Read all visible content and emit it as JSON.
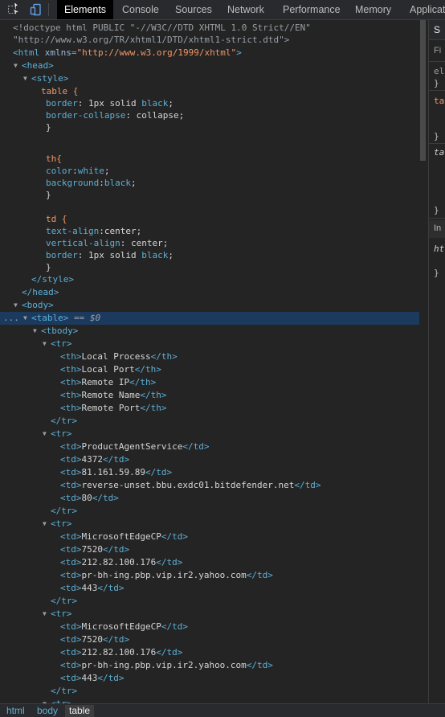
{
  "toolbar": {
    "tabs": [
      "Elements",
      "Console",
      "Sources",
      "Network",
      "Performance",
      "Memory",
      "Applicat"
    ],
    "active_tab": "Elements"
  },
  "side_panel": {
    "tab_label": "S",
    "filter_placeholder": "Fi",
    "text_el": "el",
    "brace_close_1": "}",
    "text_ta_1": "ta",
    "brace_close_2": "}",
    "text_ta_2": "ta",
    "brace_close_3": "}",
    "text_in": "In",
    "text_ht": "ht",
    "brace_close_4": "}"
  },
  "code": {
    "doctype_1": "<!doctype html PUBLIC \"-//W3C//DTD XHTML 1.0 Strict//EN\"",
    "doctype_2": "\"http://www.w3.org/TR/xhtml1/DTD/xhtml1-strict.dtd\">",
    "html_open_tag": "<html",
    "xmlns_attr": "xmlns",
    "xmlns_val": "\"http://www.w3.org/1999/xhtml\"",
    "html_close_bracket": ">",
    "head_open": "<head>",
    "style_open": "<style>",
    "css_table_sel": "table {",
    "css_border_prop": "border",
    "css_border_val_1": ": 1px solid ",
    "css_black": "black",
    "css_semicolon": ";",
    "css_collapse_prop": "border-collapse",
    "css_collapse_val": ": collapse;",
    "css_close": "}",
    "css_th_sel": "th{",
    "css_color_prop": "color",
    "css_white": "white",
    "css_background_prop": "background",
    "css_td_sel": "td {",
    "css_textalign_prop": "text-align",
    "css_textalign_val": ":center;",
    "css_valign_prop": "vertical-align",
    "css_valign_val": ": center;",
    "style_close": "</style>",
    "head_close": "</head>",
    "body_open": "<body>",
    "dots": "...",
    "table_open": "<table>",
    "eq_dollar": " == ",
    "dollar0": "$0",
    "tbody_open": "<tbody>",
    "tr_open": "<tr>",
    "tr_close": "</tr>",
    "th_open": "<th>",
    "th_close": "</th>",
    "td_open": "<td>",
    "td_close": "</td>",
    "headers": [
      "Local Process",
      "Local Port",
      "Remote IP",
      "Remote Name",
      "Remote Port"
    ],
    "rows": [
      [
        "ProductAgentService",
        "4372",
        "81.161.59.89",
        "reverse-unset.bbu.exdc01.bitdefender.net",
        "80"
      ],
      [
        "MicrosoftEdgeCP",
        "7520",
        "212.82.100.176",
        "pr-bh-ing.pbp.vip.ir2.yahoo.com",
        "443"
      ],
      [
        "MicrosoftEdgeCP",
        "7520",
        "212.82.100.176",
        "pr-bh-ing.pbp.vip.ir2.yahoo.com",
        "443"
      ]
    ]
  },
  "breadcrumbs": [
    "html",
    "body",
    "table"
  ],
  "active_breadcrumb": "table"
}
